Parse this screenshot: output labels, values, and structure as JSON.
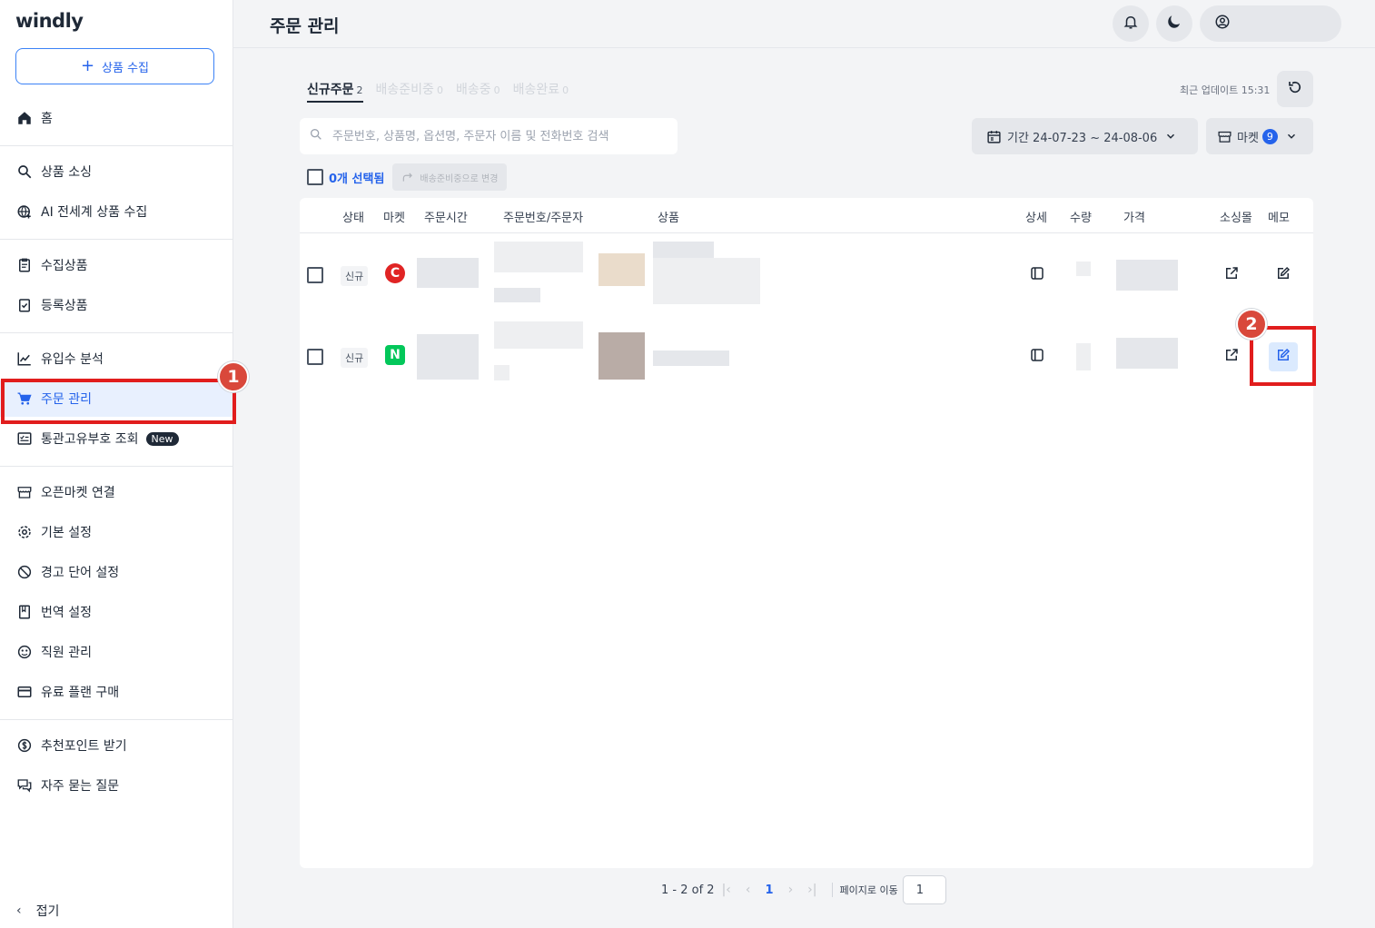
{
  "app": {
    "logo": "windly"
  },
  "sidebar": {
    "collect_button": "상품 수집",
    "items": [
      {
        "label": "홈",
        "icon": "home-icon"
      },
      {
        "label": "상품 소싱",
        "icon": "search-icon"
      },
      {
        "label": "AI 전세계 상품 수집",
        "icon": "globe-icon"
      },
      {
        "label": "수집상품",
        "icon": "clipboard-icon"
      },
      {
        "label": "등록상품",
        "icon": "checklist-icon"
      },
      {
        "label": "유입수 분석",
        "icon": "chart-line-icon"
      },
      {
        "label": "주문 관리",
        "icon": "cart-icon"
      },
      {
        "label": "통관고유부호 조회",
        "icon": "id-card-icon",
        "badge": "New"
      },
      {
        "label": "오픈마켓 연결",
        "icon": "store-icon"
      },
      {
        "label": "기본 설정",
        "icon": "gear-icon"
      },
      {
        "label": "경고 단어 설정",
        "icon": "ban-icon"
      },
      {
        "label": "번역 설정",
        "icon": "book-icon"
      },
      {
        "label": "직원 관리",
        "icon": "users-icon"
      },
      {
        "label": "유료 플랜 구매",
        "icon": "credit-card-icon"
      },
      {
        "label": "추천포인트 받기",
        "icon": "dollar-icon"
      },
      {
        "label": "자주 묻는 질문",
        "icon": "chat-icon"
      }
    ],
    "fold_label": "접기"
  },
  "header": {
    "title": "주문 관리"
  },
  "tabs": [
    {
      "label": "신규주문",
      "count": "2"
    },
    {
      "label": "배송준비중",
      "count": "0"
    },
    {
      "label": "배송중",
      "count": "0"
    },
    {
      "label": "배송완료",
      "count": "0"
    }
  ],
  "last_update": "최근 업데이트 15:31",
  "search": {
    "placeholder": "주문번호, 상품명, 옵션명, 주문자 이름 및 전화번호 검색"
  },
  "period": {
    "label": "기간 24-07-23 ~ 24-08-06"
  },
  "market_filter": {
    "label": "마켓",
    "count": "9"
  },
  "selection": {
    "selected_label": "0개 선택됨",
    "change_button": "배송준비중으로 변경"
  },
  "table": {
    "columns": [
      "상태",
      "마켓",
      "주문시간",
      "주문번호/주문자",
      "상품",
      "상세",
      "수량",
      "가격",
      "소싱몰",
      "메모"
    ],
    "rows": [
      {
        "status": "신규",
        "market_letter": "C",
        "market_color": "#e02424"
      },
      {
        "status": "신규",
        "market_letter": "N",
        "market_color": "#03c75a"
      }
    ]
  },
  "annotations": {
    "step1": "1",
    "step2": "2",
    "highlight_color": "#e11d1d"
  },
  "pagination": {
    "range": "1 - 2 of 2",
    "current": "1",
    "goto_label": "페이지로 이동",
    "goto_value": "1"
  }
}
